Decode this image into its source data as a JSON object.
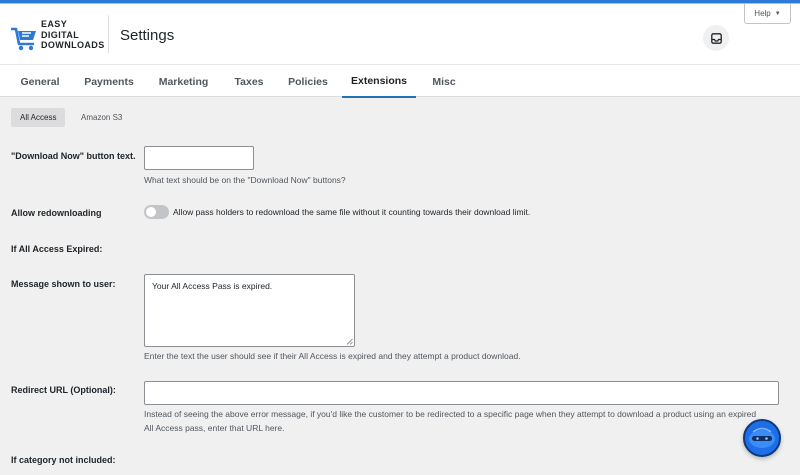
{
  "brand": {
    "line1": "EASY",
    "line2": "DIGITAL",
    "line3": "DOWNLOADS"
  },
  "header": {
    "title": "Settings",
    "help_label": "Help",
    "help_caret": "▼"
  },
  "tabs": [
    {
      "label": "General"
    },
    {
      "label": "Payments"
    },
    {
      "label": "Marketing"
    },
    {
      "label": "Taxes"
    },
    {
      "label": "Policies"
    },
    {
      "label": "Extensions"
    },
    {
      "label": "Misc"
    }
  ],
  "active_tab": "Extensions",
  "subtabs": [
    {
      "label": "All Access"
    },
    {
      "label": "Amazon S3"
    }
  ],
  "active_subtab": "All Access",
  "form": {
    "download_now": {
      "label": "\"Download Now\" button text.",
      "value": "",
      "description": "What text should be on the \"Download Now\" buttons?"
    },
    "allow_redownloading": {
      "label": "Allow redownloading",
      "enabled": false,
      "text": "Allow pass holders to redownload the same file without it counting towards their download limit."
    },
    "if_expired_heading": "If All Access Expired:",
    "message": {
      "label": "Message shown to user:",
      "value": "Your All Access Pass is expired.",
      "description": "Enter the text the user should see if their All Access is expired and they attempt a product download."
    },
    "redirect": {
      "label": "Redirect URL (Optional):",
      "value": "",
      "description_line1": "Instead of seeing the above error message, if you'd like the customer to be redirected to a specific page when they attempt to download a product using an expired",
      "description_line2": "All Access pass, enter that URL here."
    },
    "category_heading": "If category not included:"
  },
  "colors": {
    "accent": "#2271b1",
    "topbar": "#2c7ad6",
    "background": "#f0f0f1",
    "chat": "#1e6ee8"
  },
  "icons": {
    "logo": "edd-logo-icon",
    "inbox": "inbox-icon",
    "chat": "chat-widget-icon"
  }
}
